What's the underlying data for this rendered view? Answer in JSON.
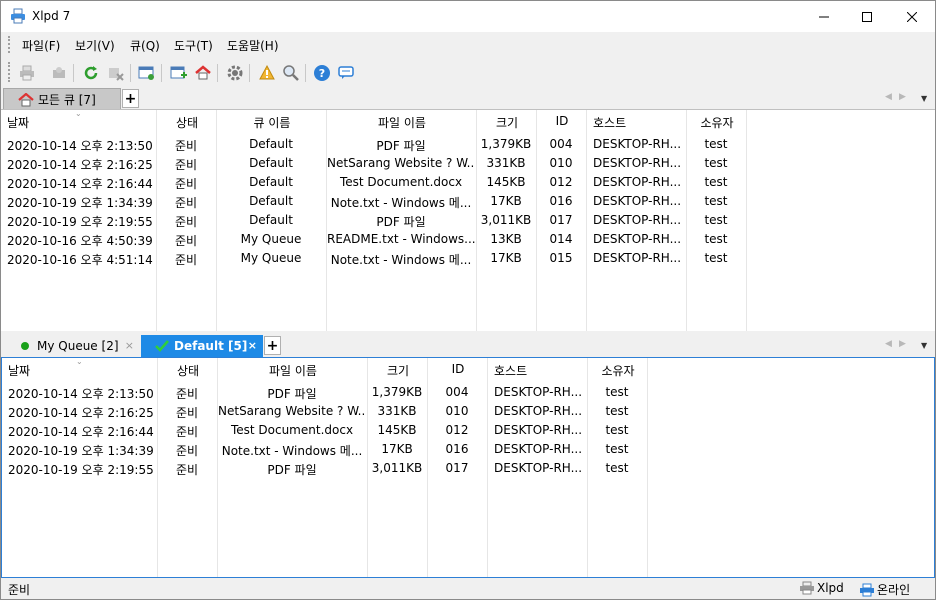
{
  "window": {
    "title": "Xlpd 7"
  },
  "menu": [
    "파일(F)",
    "보기(V)",
    "큐(Q)",
    "도구(T)",
    "도움말(H)"
  ],
  "toolbar_icons": [
    "print-icon",
    "print-preview-icon",
    "refresh-icon",
    "delete-job-icon",
    "queue-settings-icon",
    "add-queue-icon",
    "home-icon",
    "gear-icon",
    "alert-icon",
    "search-icon",
    "help-icon",
    "chat-icon"
  ],
  "top_tabs": [
    {
      "label": "모든 큐 [7]",
      "icon": "home-icon"
    }
  ],
  "top_columns": [
    "날짜",
    "상태",
    "큐 이름",
    "파일 이름",
    "크기",
    "ID",
    "호스트",
    "소유자"
  ],
  "top_rows": [
    [
      "2020-10-14 오후 2:13:50",
      "준비",
      "Default",
      "PDF 파일",
      "1,379KB",
      "004",
      "DESKTOP-RH...",
      "test"
    ],
    [
      "2020-10-14 오후 2:16:25",
      "준비",
      "Default",
      "NetSarang Website ? W...",
      "331KB",
      "010",
      "DESKTOP-RH...",
      "test"
    ],
    [
      "2020-10-14 오후 2:16:44",
      "준비",
      "Default",
      "Test Document.docx",
      "145KB",
      "012",
      "DESKTOP-RH...",
      "test"
    ],
    [
      "2020-10-19 오후 1:34:39",
      "준비",
      "Default",
      "Note.txt - Windows 메...",
      "17KB",
      "016",
      "DESKTOP-RH...",
      "test"
    ],
    [
      "2020-10-19 오후 2:19:55",
      "준비",
      "Default",
      "PDF 파일",
      "3,011KB",
      "017",
      "DESKTOP-RH...",
      "test"
    ],
    [
      "2020-10-16 오후 4:50:39",
      "준비",
      "My Queue",
      "README.txt - Windows...",
      "13KB",
      "014",
      "DESKTOP-RH...",
      "test"
    ],
    [
      "2020-10-16 오후 4:51:14",
      "준비",
      "My Queue",
      "Note.txt - Windows 메...",
      "17KB",
      "015",
      "DESKTOP-RH...",
      "test"
    ]
  ],
  "bottom_tabs": [
    {
      "label": "My Queue [2]",
      "status_color": "#1aa11a"
    },
    {
      "label": "Default [5]",
      "status_color": "#1aa11a"
    }
  ],
  "bottom_columns": [
    "날짜",
    "상태",
    "파일 이름",
    "크기",
    "ID",
    "호스트",
    "소유자"
  ],
  "bottom_rows": [
    [
      "2020-10-14 오후 2:13:50",
      "준비",
      "PDF 파일",
      "1,379KB",
      "004",
      "DESKTOP-RH...",
      "test"
    ],
    [
      "2020-10-14 오후 2:16:25",
      "준비",
      "NetSarang Website ? W...",
      "331KB",
      "010",
      "DESKTOP-RH...",
      "test"
    ],
    [
      "2020-10-14 오후 2:16:44",
      "준비",
      "Test Document.docx",
      "145KB",
      "012",
      "DESKTOP-RH...",
      "test"
    ],
    [
      "2020-10-19 오후 1:34:39",
      "준비",
      "Note.txt - Windows 메...",
      "17KB",
      "016",
      "DESKTOP-RH...",
      "test"
    ],
    [
      "2020-10-19 오후 2:19:55",
      "준비",
      "PDF 파일",
      "3,011KB",
      "017",
      "DESKTOP-RH...",
      "test"
    ]
  ],
  "status": {
    "left": "준비",
    "printer_label": "Xlpd",
    "online_label": "온라인"
  },
  "colors": {
    "active_tab": "#1e8ae6",
    "accent_border": "#2d7fd6"
  }
}
